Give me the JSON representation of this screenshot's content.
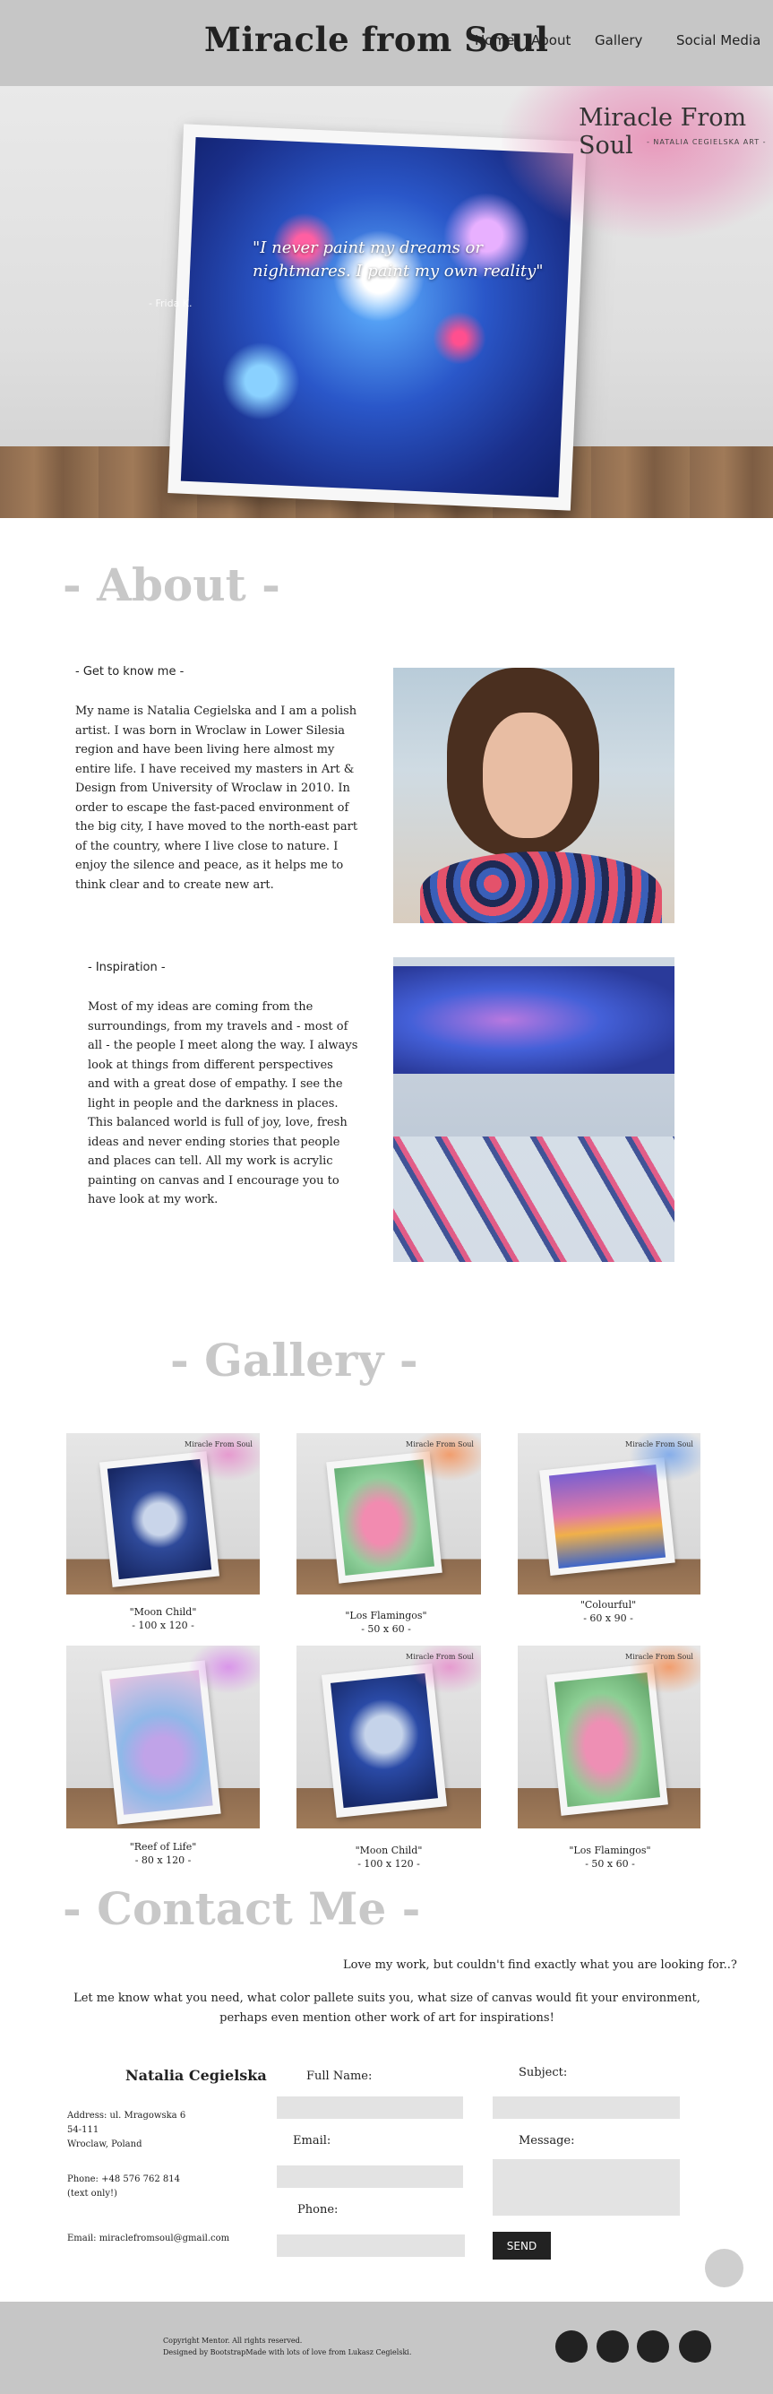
{
  "header": {
    "brand": "Miracle from Soul",
    "nav": [
      "Home",
      "About",
      "Gallery",
      "Social Media"
    ]
  },
  "hero": {
    "logo": "Miracle From Soul",
    "logo_sub": "- NATALIA CEGIELSKA ART -",
    "quote": "\"I never paint my dreams or nightmares. I paint my own reality\"",
    "author": "- Frida K."
  },
  "about": {
    "title": "- About -",
    "intro_head": "- Get to know me -",
    "intro_text": "My name is Natalia Cegielska and I am a polish artist. I was born in Wroclaw in Lower Silesia region and have been living here almost my entire life. I have received my masters in Art & Design from University of Wroclaw in 2010. In order to escape the fast-paced environment of the big city, I have moved to the north-east part of the country, where I live close to nature. I enjoy the silence and peace, as it helps me to think clear and to create new art.",
    "insp_head": "- Inspiration -",
    "insp_text": "Most of my ideas are coming from the surroundings, from my travels and - most of all - the people I meet along the way. I always look at things from different perspectives and with a great dose of empathy. I see the light in people and the darkness in places. This balanced world is full of joy, love, fresh ideas and never ending stories that people and places can tell. All my work is acrylic painting on canvas and I encourage you to have look at my work."
  },
  "gallery": {
    "title": "- Gallery -",
    "watermark": "Miracle From Soul",
    "items": [
      {
        "name": "\"Moon Child\"",
        "size": "- 100 x 120 -"
      },
      {
        "name": "\"Los Flamingos\"",
        "size": "- 50 x 60 -"
      },
      {
        "name": "\"Colourful\"",
        "size": "- 60 x 90 -"
      },
      {
        "name": "\"Reef of Life\"",
        "size": "- 80 x 120 -"
      },
      {
        "name": "\"Moon Child\"",
        "size": "- 100 x 120 -"
      },
      {
        "name": "\"Los Flamingos\"",
        "size": "- 50 x 60 -"
      }
    ]
  },
  "contact": {
    "title": "- Contact Me -",
    "lead1": "Love my work, but couldn't find exactly what you are looking for..?",
    "lead2a": "Let me know what you need, what color pallete suits you, what size of canvas would fit your environment,",
    "lead2b": "perhaps even mention other work of art for inspirations!",
    "name": "Natalia Cegielska",
    "address1": "Address: ul. Mragowska 6",
    "address2": "54-111",
    "address3": "Wroclaw, Poland",
    "phone1": "Phone: +48 576 762 814",
    "phone2": "(text only!)",
    "email": "Email: miraclefromsoul@gmail.com",
    "labels": {
      "full_name": "Full Name:",
      "subject": "Subject:",
      "email": "Email:",
      "message": "Message:",
      "phone": "Phone:"
    },
    "send": "SEND"
  },
  "footer": {
    "copyright": "Copyright Mentor. All rights reserved.",
    "designed": "Designed by BootstrapMade with lots of love from Lukasz Cegielski."
  }
}
